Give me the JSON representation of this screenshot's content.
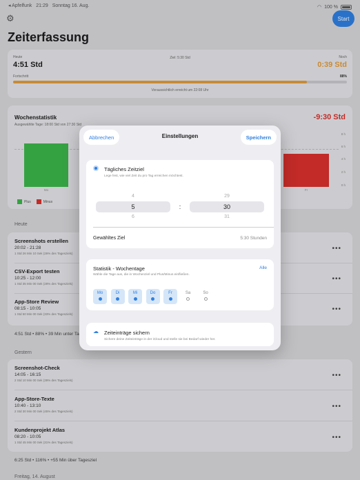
{
  "status_bar": {
    "back_app": "◂ Apfelfunk",
    "time": "21:29",
    "date": "Sonntag 16. Aug.",
    "battery": "100 %"
  },
  "header": {
    "title": "Zeiterfassung",
    "start_label": "Start"
  },
  "summary": {
    "today_label": "Heute",
    "today_value": "4:51 Std",
    "goal_label": "Ziel: 5:30 Std",
    "remaining_label": "Noch",
    "remaining_value": "0:39 Std",
    "progress_label": "Fortschritt",
    "progress_pct_text": "88%",
    "progress": 0.88,
    "eta": "Voraussichtlich erreicht um 22:08 Uhr"
  },
  "weekly": {
    "title": "Wochenstatistik",
    "subtitle": "Ausgewählte Tage: 18:00 Std von 27:30 Std",
    "delta": "-9:30 Std",
    "y_ticks": [
      "8 h",
      "6 h",
      "4 h",
      "2 h",
      "0 h"
    ],
    "first_bar_label": "Mo",
    "last_bar_label": "Fr",
    "legend": [
      {
        "label": "Plus",
        "color": "#3bb54a"
      },
      {
        "label": "Minus",
        "color": "#d9302c"
      }
    ]
  },
  "today_section": {
    "header": "Heute",
    "entries": [
      {
        "title": "Screenshots erstellen",
        "time": "20:02 - 21:28",
        "detail": "1 Std 26 Min 10 Sek (26% des Tagesziels)"
      },
      {
        "title": "CSV-Export testen",
        "time": "10:25 - 12:00",
        "detail": "1 Std 35 Min 00 Sek (28% des Tagesziels)"
      },
      {
        "title": "App-Store Review",
        "time": "08:15 - 10:05",
        "detail": "1 Std 50 Min 00 Sek (33% des Tagesziels)"
      }
    ],
    "footer": "4:51 Std • 88% • 39 Min unter Tagesziel"
  },
  "yesterday_section": {
    "header": "Gestern",
    "entries": [
      {
        "title": "Screenshot-Check",
        "time": "14:05 - 16:15",
        "detail": "2 Std 10 Min 00 Sek (39% des Tagesziels)"
      },
      {
        "title": "App-Store-Texte",
        "time": "10:40 - 13:10",
        "detail": "2 Std 30 Min 00 Sek (45% des Tagesziels)"
      },
      {
        "title": "Kundenprojekt Atlas",
        "time": "08:20 - 10:05",
        "detail": "1 Std 45 Min 00 Sek (31% des Tagesziels)"
      }
    ],
    "footer": "6:25 Std • 116% • +55 Min über Tagesziel"
  },
  "next_section": {
    "header": "Freitag, 14. August"
  },
  "modal": {
    "cancel": "Abbrechen",
    "title": "Einstellungen",
    "save": "Speichern",
    "goal": {
      "title": "Tägliches Zeitziel",
      "desc": "Lege fest, wie viel Zeit du pro Tag erreichen möchtest.",
      "hours_above": "4",
      "hours": "5",
      "hours_below": "6",
      "separator": ":",
      "minutes_above": "29",
      "minutes": "30",
      "minutes_below": "31",
      "chosen_label": "Gewähltes Ziel",
      "chosen_value": "5:30 Stunden"
    },
    "weekdays": {
      "title": "Statistik - Wochentage",
      "all": "Alle",
      "desc": "Wähle die Tage aus, die in Wochenziel und Plus/Minus einfließen.",
      "days": [
        {
          "label": "Mo",
          "on": true
        },
        {
          "label": "Di",
          "on": true
        },
        {
          "label": "Mi",
          "on": true
        },
        {
          "label": "Do",
          "on": true
        },
        {
          "label": "Fr",
          "on": true
        },
        {
          "label": "Sa",
          "on": false
        },
        {
          "label": "So",
          "on": false
        }
      ]
    },
    "backup": {
      "title": "Zeiteinträge sichern",
      "desc": "Sichere deine Zeiteinträge in der iCloud und stelle sie bei Bedarf wieder her."
    }
  }
}
